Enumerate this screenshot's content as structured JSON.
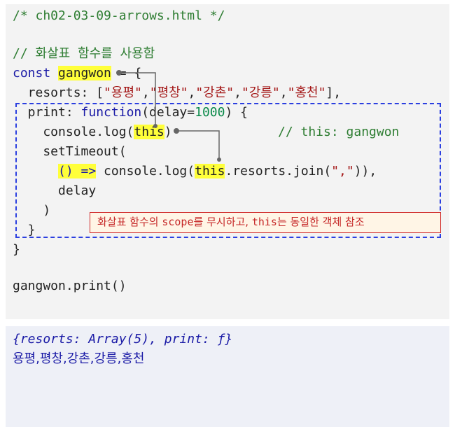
{
  "code": {
    "file_comment": "/* ch02-03-09-arrows.html */",
    "arrow_comment": "// 화살표 함수를 사용함",
    "kw_const": "const",
    "obj_name": "gangwon",
    "assign": " = {",
    "resorts_key": "  resorts: [",
    "resorts": [
      "\"용평\"",
      "\"평창\"",
      "\"강촌\"",
      "\"강릉\"",
      "\"홍천\""
    ],
    "comma": ",",
    "resorts_close": "],",
    "print_key": "  print: ",
    "kw_function": "function",
    "param_open": "(delay=",
    "param_default": "1000",
    "param_close": ") {",
    "console_log_open": "    console.log(",
    "this_kw": "this",
    "console_log_close": ")",
    "this_comment": "// this: gangwon",
    "set_timeout": "    setTimeout(",
    "arrow_indent": "      ",
    "arrow_fn": "() =>",
    "arrow_body_1": " console.log(",
    "arrow_body_2": ".resorts.join(",
    "join_sep": "\",\"",
    "arrow_body_3": ")),",
    "delay_line": "      delay",
    "paren_close": "    )",
    "print_close": "  }",
    "obj_close": "}",
    "call_line": "gangwon.print()"
  },
  "note": {
    "part1": "화살표 함수의 ",
    "scope": "scope",
    "part2": "를 무시하고, ",
    "this": "this",
    "part3": "는 동일한 객체 참조"
  },
  "output": {
    "object_line": "{resorts: Array(5), print: ƒ}",
    "log_line": "용평,평창,강촌,강릉,홍천"
  }
}
